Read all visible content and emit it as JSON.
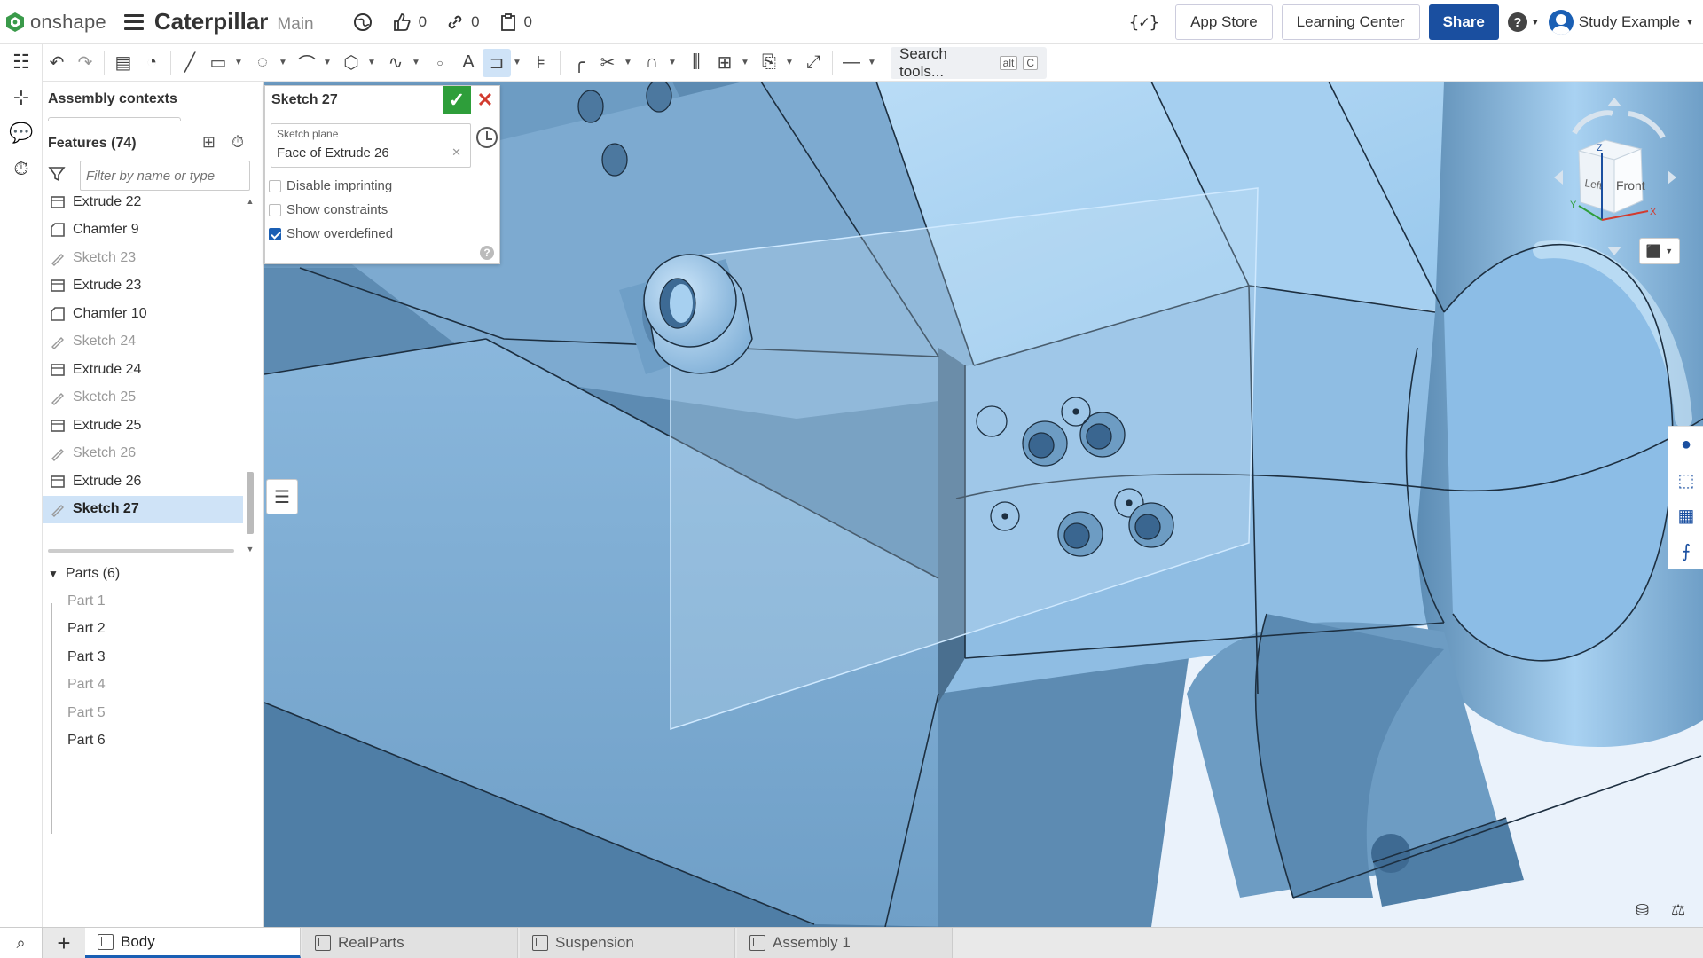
{
  "header": {
    "brand": "onshape",
    "doc_title": "Caterpillar",
    "branch": "Main",
    "likes": "0",
    "links": "0",
    "copies": "0",
    "app_store": "App Store",
    "learning_center": "Learning Center",
    "share": "Share",
    "help": "?",
    "user_name": "Study Example"
  },
  "toolbar": {
    "search_placeholder": "Search tools...",
    "shortcut_alt": "alt",
    "shortcut_key": "C"
  },
  "feature_panel": {
    "assembly_contexts": "Assembly contexts",
    "features_title": "Features (74)",
    "filter_placeholder": "Filter by name or type",
    "features": [
      {
        "label": "Extrude 22",
        "type": "extrude",
        "dim": false,
        "selected": false
      },
      {
        "label": "Chamfer 9",
        "type": "chamfer",
        "dim": false,
        "selected": false
      },
      {
        "label": "Sketch 23",
        "type": "sketch",
        "dim": true,
        "selected": false
      },
      {
        "label": "Extrude 23",
        "type": "extrude",
        "dim": false,
        "selected": false
      },
      {
        "label": "Chamfer 10",
        "type": "chamfer",
        "dim": false,
        "selected": false
      },
      {
        "label": "Sketch 24",
        "type": "sketch",
        "dim": true,
        "selected": false
      },
      {
        "label": "Extrude 24",
        "type": "extrude",
        "dim": false,
        "selected": false
      },
      {
        "label": "Sketch 25",
        "type": "sketch",
        "dim": true,
        "selected": false
      },
      {
        "label": "Extrude 25",
        "type": "extrude",
        "dim": false,
        "selected": false
      },
      {
        "label": "Sketch 26",
        "type": "sketch",
        "dim": true,
        "selected": false
      },
      {
        "label": "Extrude 26",
        "type": "extrude",
        "dim": false,
        "selected": false
      },
      {
        "label": "Sketch 27",
        "type": "sketch",
        "dim": false,
        "selected": true
      }
    ],
    "parts_title": "Parts (6)",
    "parts": [
      {
        "label": "Part 1",
        "dim": true
      },
      {
        "label": "Part 2",
        "dim": false
      },
      {
        "label": "Part 3",
        "dim": false
      },
      {
        "label": "Part 4",
        "dim": true
      },
      {
        "label": "Part 5",
        "dim": true
      },
      {
        "label": "Part 6",
        "dim": false
      }
    ]
  },
  "sketch_dialog": {
    "title": "Sketch 27",
    "plane_label": "Sketch plane",
    "plane_value": "Face of Extrude 26",
    "disable_imprinting": "Disable imprinting",
    "show_constraints": "Show constraints",
    "show_overdefined": "Show overdefined",
    "disable_imprinting_checked": false,
    "show_constraints_checked": false,
    "show_overdefined_checked": true
  },
  "view_cube": {
    "front": "Front",
    "left": "Left",
    "axis_z": "Z",
    "axis_y": "Y",
    "axis_x": "X"
  },
  "tabs": [
    {
      "label": "Body",
      "active": true
    },
    {
      "label": "RealParts",
      "active": false
    },
    {
      "label": "Suspension",
      "active": false
    },
    {
      "label": "Assembly 1",
      "active": false
    }
  ],
  "colors": {
    "accent": "#1a4fa0",
    "selection": "#cfe3f7",
    "model_light": "#a8d0f0",
    "model_mid": "#7aaed6",
    "model_dark": "#4f7ea6",
    "confirm": "#2e9e3a",
    "cancel": "#d23b2f"
  }
}
